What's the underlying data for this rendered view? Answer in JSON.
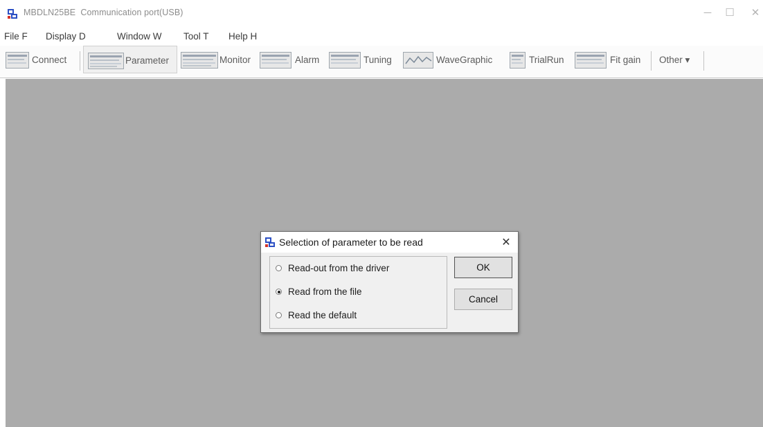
{
  "window": {
    "title": "MBDLN25BE  Communication port(USB)",
    "minimize_glyph": "─",
    "maximize_glyph": "☐",
    "close_glyph": "✕"
  },
  "menu": {
    "items": [
      "File F",
      "Display D",
      "Window W",
      "Tool T",
      "Help H"
    ]
  },
  "toolbar": {
    "buttons": [
      {
        "label": "Connect",
        "icon": "connect-icon"
      },
      {
        "label": "Parameter",
        "icon": "parameter-icon"
      },
      {
        "label": "Monitor",
        "icon": "monitor-icon"
      },
      {
        "label": "Alarm",
        "icon": "alarm-icon"
      },
      {
        "label": "Tuning",
        "icon": "tuning-icon"
      },
      {
        "label": "WaveGraphic",
        "icon": "wavegraphic-icon"
      },
      {
        "label": "TrialRun",
        "icon": "trialrun-icon"
      },
      {
        "label": "Fit gain",
        "icon": "fitgain-icon"
      },
      {
        "label": "Other ▾",
        "icon": "chevron-down-icon"
      }
    ]
  },
  "dialog": {
    "title": "Selection of parameter to be read",
    "close_glyph": "✕",
    "options": [
      {
        "label": "Read-out from the driver",
        "selected": false
      },
      {
        "label": "Read from the file",
        "selected": true
      },
      {
        "label": "Read the default",
        "selected": false
      }
    ],
    "ok_label": "OK",
    "cancel_label": "Cancel"
  },
  "colors": {
    "workspace": "#ababab",
    "dialog_bg": "#f0f0f0",
    "icon_blue": "#2b4fc4",
    "icon_red": "#d6342a"
  }
}
